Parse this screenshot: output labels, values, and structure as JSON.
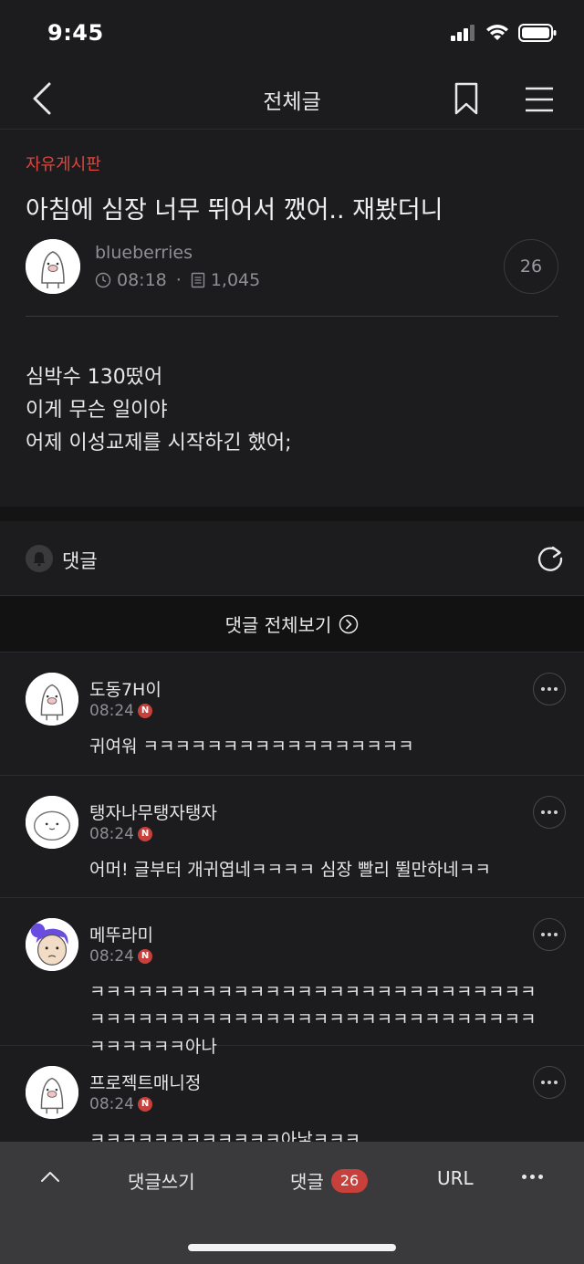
{
  "status_bar": {
    "time": "9:45"
  },
  "nav": {
    "title": "전체글"
  },
  "post": {
    "board": "자유게시판",
    "title": "아침에 심장 너무 뛰어서 깼어.. 재봤더니",
    "author": "blueberries",
    "time": "08:18",
    "views": "1,045",
    "comment_count": "26",
    "body": [
      "심박수 130떴어",
      "이게 무슨 일이야",
      "어제 이성교제를 시작하긴 했어;"
    ]
  },
  "comments_section": {
    "header": "댓글",
    "view_all": "댓글 전체보기",
    "items": [
      {
        "name": "도동7H이",
        "time": "08:24",
        "new_badge": "N",
        "text": "귀여워 ㅋㅋㅋㅋㅋㅋㅋㅋㅋㅋㅋㅋㅋㅋㅋㅋㅋ"
      },
      {
        "name": "탱자나무탱자탱자",
        "time": "08:24",
        "new_badge": "N",
        "text": "어머! 글부터 개귀엽네ㅋㅋㅋㅋ 심장 빨리 뛸만하네ㅋㅋ"
      },
      {
        "name": "메뚜라미",
        "time": "08:24",
        "new_badge": "N",
        "text": "ㅋㅋㅋㅋㅋㅋㅋㅋㅋㅋㅋㅋㅋㅋㅋㅋㅋㅋㅋㅋㅋㅋㅋㅋㅋㅋㅋㅋㅋㅋㅋㅋㅋㅋㅋㅋㅋㅋㅋㅋㅋㅋㅋㅋㅋㅋㅋㅋㅋㅋㅋㅋㅋㅋㅋㅋㅋㅋㅋㅋㅋㅋ아나"
      },
      {
        "name": "프로젝트매니정",
        "time": "08:24",
        "new_badge": "N",
        "text": "ㅋㅋㅋㅋㅋㅋㅋㅋㅋㅋㅋㅋ아낳ㅋㅋㅋ"
      }
    ]
  },
  "bottom_bar": {
    "write_label": "댓글쓰기",
    "comments_label": "댓글",
    "comments_count": "26",
    "url_label": "URL"
  },
  "colors": {
    "accent_red": "#e0453f",
    "badge_red": "#c8403b",
    "background": "#1c1c1e",
    "bottom_bar": "#3a3a3c"
  }
}
